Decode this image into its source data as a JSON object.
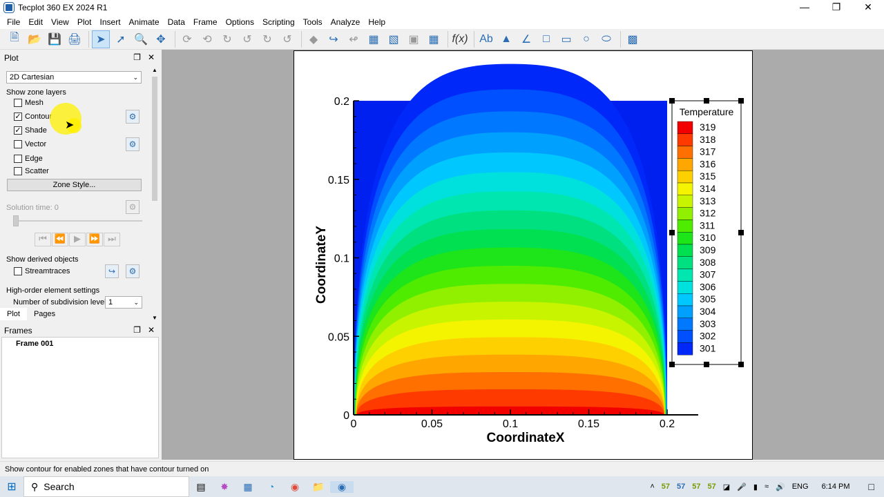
{
  "app": {
    "title": "Tecplot 360 EX 2024 R1"
  },
  "menu": [
    "File",
    "Edit",
    "View",
    "Plot",
    "Insert",
    "Animate",
    "Data",
    "Frame",
    "Options",
    "Scripting",
    "Tools",
    "Analyze",
    "Help"
  ],
  "plot_panel": {
    "title": "Plot",
    "plot_type": "2D Cartesian",
    "zone_layers_label": "Show zone layers",
    "layers": [
      {
        "label": "Mesh",
        "checked": false
      },
      {
        "label": "Contour",
        "checked": true
      },
      {
        "label": "Shade",
        "checked": true
      },
      {
        "label": "Vector",
        "checked": false
      },
      {
        "label": "Edge",
        "checked": false
      },
      {
        "label": "Scatter",
        "checked": false
      }
    ],
    "zone_style_label": "Zone Style...",
    "solution_time_label": "Solution time: 0",
    "derived_label": "Show derived objects",
    "streamtraces_label": "Streamtraces",
    "high_order_label": "High-order element settings",
    "subdivision_label": "Number of subdivision levels:",
    "subdivision_value": "1",
    "tabs": [
      "Plot",
      "Pages"
    ]
  },
  "frames_panel": {
    "title": "Frames",
    "frames": [
      "Frame 001"
    ]
  },
  "status": {
    "text": "Show contour for enabled zones that have contour turned on"
  },
  "taskbar": {
    "search_label": "Search",
    "temps": [
      "57",
      "57",
      "57",
      "57"
    ],
    "lang": "ENG",
    "time": "6:14 PM"
  },
  "chart_data": {
    "type": "heatmap",
    "xlabel": "CoordinateX",
    "ylabel": "CoordinateY",
    "xlim": [
      0,
      0.2
    ],
    "ylim": [
      0,
      0.2
    ],
    "xticks": [
      "0",
      "0.05",
      "0.1",
      "0.15",
      "0.2"
    ],
    "yticks": [
      "0",
      "0.05",
      "0.1",
      "0.15",
      "0.2"
    ],
    "legend_title": "Temperature",
    "levels": [
      319,
      318,
      317,
      316,
      315,
      314,
      313,
      312,
      311,
      310,
      309,
      308,
      307,
      306,
      305,
      304,
      303,
      302,
      301
    ],
    "level_colors": [
      "#f20000",
      "#ff3a00",
      "#ff7000",
      "#ffa600",
      "#ffd000",
      "#f4f400",
      "#c8f400",
      "#90f000",
      "#50ec00",
      "#1ee41a",
      "#00e050",
      "#00e080",
      "#00e6b0",
      "#00e0dc",
      "#00c8ff",
      "#00a0ff",
      "#0078ff",
      "#0050ff",
      "#0028f8"
    ],
    "background_color": "#0020f0"
  }
}
